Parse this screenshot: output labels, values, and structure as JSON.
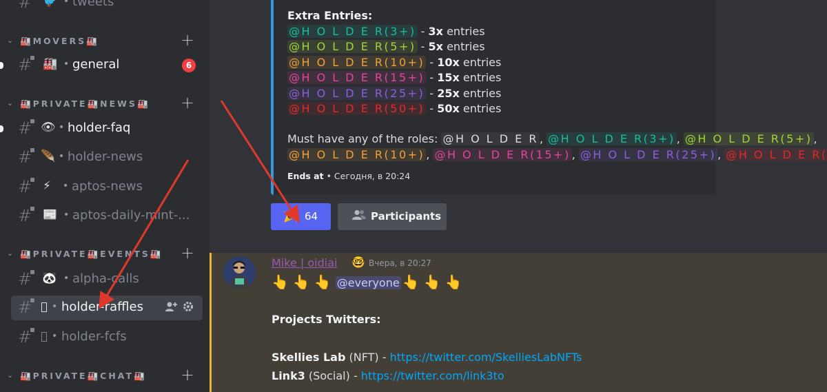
{
  "sidebar": {
    "top_channel": {
      "emoji": "🐦",
      "name": "tweets"
    },
    "categories": [
      {
        "label": "🏭MOVERS🏭"
      },
      {
        "label": "🏭PRIVATE🏭NEWS🏭"
      },
      {
        "label": "🏭PRIVATE🏭EVENTS🏭"
      },
      {
        "label": "🏭PRIVATE🏭CHAT🏭"
      }
    ],
    "channels": {
      "general": {
        "emoji": "🏭",
        "name": "general",
        "badge": "6"
      },
      "holder_faq": {
        "emoji": "👁",
        "name": "holder-faq"
      },
      "holder_news": {
        "emoji": "🪶",
        "name": "holder-news"
      },
      "aptos_news": {
        "emoji": "⚡",
        "name": "aptos-news"
      },
      "aptos_daily": {
        "emoji": "📰",
        "name": "aptos-daily-mint-..."
      },
      "alpha_calls": {
        "emoji": "🐼",
        "name": "alpha-calls"
      },
      "holder_raffles": {
        "name": "holder-raffles"
      },
      "holder_fcfs": {
        "name": "holder-fcfs"
      }
    },
    "dot": "•",
    "hash": "#",
    "plus": "+",
    "chevron": "⌄"
  },
  "embed": {
    "title": "Extra Entries:",
    "role_holder": "@H O L D E R",
    "entries": [
      {
        "role": "@H O L D E R(3+)",
        "sep": " - ",
        "mult": "3x",
        "suffix": " entries"
      },
      {
        "role": "@H O L D E R(5+)",
        "sep": " - ",
        "mult": "5x",
        "suffix": " entries"
      },
      {
        "role": "@H O L D E R(10+)",
        "sep": " - ",
        "mult": "10x",
        "suffix": " entries"
      },
      {
        "role": "@H O L D E R(15+)",
        "sep": " - ",
        "mult": "15x",
        "suffix": " entries"
      },
      {
        "role": "@H O L D E R(25+)",
        "sep": " - ",
        "mult": "25x",
        "suffix": " entries"
      },
      {
        "role": "@H O L D E R(50+)",
        "sep": " - ",
        "mult": "50x",
        "suffix": " entries"
      }
    ],
    "must_have": "Must have any of the roles: ",
    "comma": ", ",
    "ends_label": "Ends at",
    "ends_value": " • Сегодня, в 20:24"
  },
  "buttons": {
    "reaction_emoji": "🎉",
    "reaction_count": "64",
    "participants_icon": "👥",
    "participants_label": "Participants"
  },
  "message": {
    "author": "Mike | oidiai",
    "author_emoji": "🤓",
    "timestamp": "Вчера, в 20:27",
    "fingers_left": "👆👆👆",
    "everyone": "@everyone",
    "fingers_right": "👆👆👆",
    "projects_heading": "Projects Twitters:",
    "links": [
      {
        "name": "Skellies Lab",
        "tag": " (NFT) - ",
        "url": "https://twitter.com/SkelliesLabNFTs"
      },
      {
        "name": "Link3",
        "tag": " (Social) - ",
        "url": "https://twitter.com/link3to"
      }
    ]
  },
  "colors": {
    "accent": "#5865f2",
    "arrow": "#e0392b",
    "embed_border": "#3498db",
    "mention_border": "#f0b232",
    "badge": "#f23f42"
  }
}
